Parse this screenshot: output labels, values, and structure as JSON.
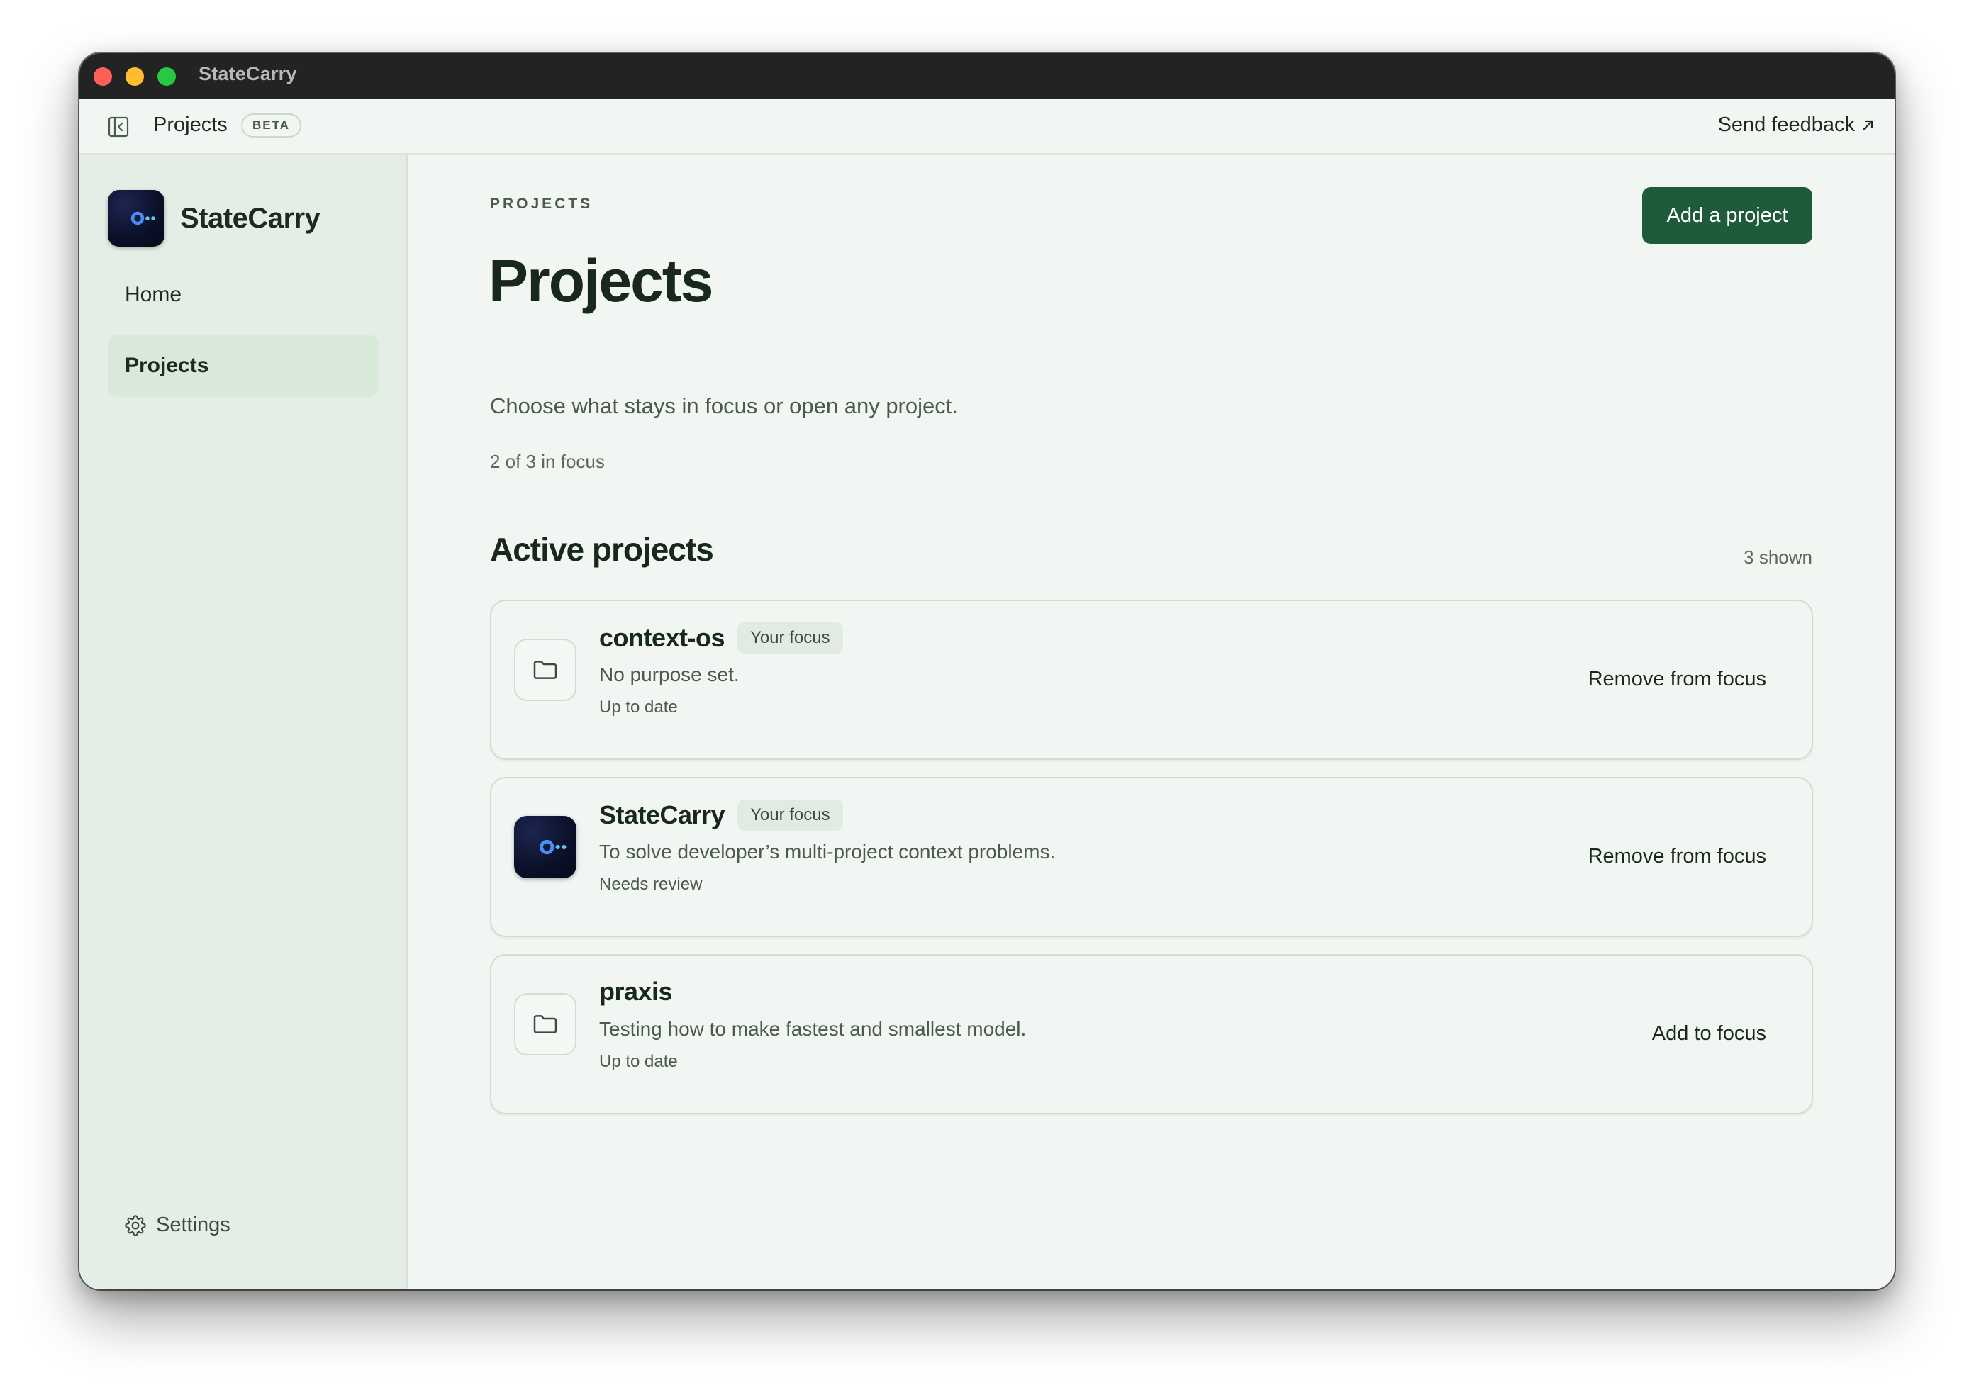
{
  "window": {
    "title": "StateCarry"
  },
  "toolbar": {
    "title": "Projects",
    "badge": "BETA",
    "feedback_label": "Send feedback",
    "feedback_icon": "arrow-up-right-icon"
  },
  "sidebar": {
    "brand_name": "StateCarry",
    "items": [
      {
        "label": "Home",
        "active": false
      },
      {
        "label": "Projects",
        "active": true
      }
    ],
    "settings_label": "Settings",
    "settings_icon": "gear-icon"
  },
  "main": {
    "eyebrow": "PROJECTS",
    "title": "Projects",
    "subtitle": "Choose what stays in focus or open any project.",
    "focus_count": "2 of 3 in focus",
    "add_button": "Add a project",
    "section_title": "Active projects",
    "shown_count": "3 shown",
    "projects": [
      {
        "name": "context-os",
        "tag": "Your focus",
        "description": "No purpose set.",
        "status": "Up to date",
        "action": "Remove from focus",
        "icon": "folder-icon"
      },
      {
        "name": "StateCarry",
        "tag": "Your focus",
        "description": "To solve developer’s multi-project context problems.",
        "status": "Needs review",
        "action": "Remove from focus",
        "icon": "statecarry-logo-icon"
      },
      {
        "name": "praxis",
        "tag": "",
        "description": "Testing how to make fastest and smallest model.",
        "status": "Up to date",
        "action": "Add to focus",
        "icon": "folder-icon"
      }
    ]
  },
  "colors": {
    "accent": "#1f5a3a",
    "background": "#f2f6f2",
    "sidebar": "#e5eee6",
    "titlebar": "#232323"
  }
}
